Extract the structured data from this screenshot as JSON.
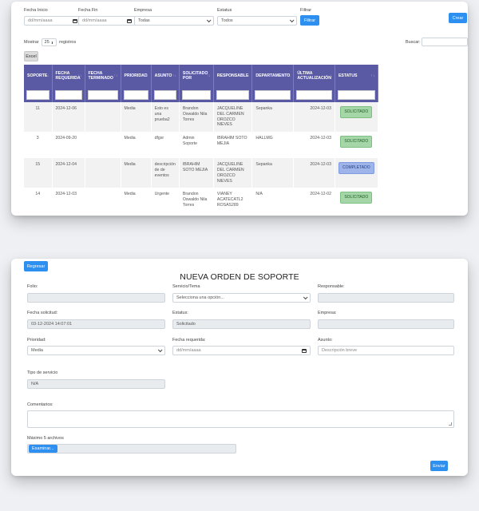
{
  "list_view": {
    "filters": {
      "fecha_inicio": {
        "label": "Fecha Inicio",
        "placeholder": "dd/mm/aaaa"
      },
      "fecha_fin": {
        "label": "Fecha Fin",
        "placeholder": "dd/mm/aaaa"
      },
      "empresa": {
        "label": "Empresa",
        "value": "Todas"
      },
      "estatus": {
        "label": "Estatus",
        "value": "Todos"
      },
      "filtrar": {
        "label": "Filtrar",
        "button": "Filtrar"
      }
    },
    "crear_button": "Crear",
    "mostrar": {
      "prefix": "Mostrar",
      "value": "25",
      "suffix": "registros"
    },
    "buscar_label": "Buscar:",
    "excel_button": "Excel",
    "columns": [
      "SOPORTE",
      "FECHA REQUERIDA",
      "FECHA TERMINADO",
      "PRIORIDAD",
      "ASUNTO",
      "SOLICITADO POR",
      "RESPONSABLE",
      "DEPARTAMENTO",
      "ÚLTIMA ACTUALIZACIÓN",
      "ESTATUS"
    ],
    "sort_icons": [
      "↑↓",
      "↑↓",
      "↑↓",
      "↑↓",
      "↑↓",
      "↑↓",
      "↑↓",
      "↑↓",
      "↓",
      "↑↓"
    ],
    "rows": [
      {
        "soporte": "11",
        "fecha_requerida": "2024-12-06",
        "fecha_terminado": "",
        "prioridad": "Media",
        "asunto": "Esto es una prueba2",
        "solicitado_por": "Brandon Oswaldo Nila Torres",
        "responsable": "JACQUELINE DEL CARMEN OROZCO NIEVES",
        "departamento": "Sepanka",
        "ultima_actualizacion": "2024-12-03",
        "estatus": "SOLICITADO",
        "estatus_color": "green"
      },
      {
        "soporte": "3",
        "fecha_requerida": "2024-09-20",
        "fecha_terminado": "",
        "prioridad": "Media",
        "asunto": "dfgsr",
        "solicitado_por": "Admin Soporte",
        "responsable": "IBRAHIM SOTO MEJIA",
        "departamento": "HALLMG",
        "ultima_actualizacion": "2024-12-03",
        "estatus": "SOLICITADO",
        "estatus_color": "green"
      },
      {
        "soporte": "15",
        "fecha_requerida": "2024-12-04",
        "fecha_terminado": "",
        "prioridad": "Media",
        "asunto": "descripción de de eventos",
        "solicitado_por": "IBRAHIM SOTO MEJIA",
        "responsable": "JACQUELINE DEL CARMEN OROZCO NIEVES",
        "departamento": "Sepanka",
        "ultima_actualizacion": "2024-12-03",
        "estatus": "COMPLETADO",
        "estatus_color": "blue"
      },
      {
        "soporte": "14",
        "fecha_requerida": "2024-12-03",
        "fecha_terminado": "",
        "prioridad": "Media",
        "asunto": "Urgente",
        "solicitado_por": "Brandon Oswaldo Nila Torres",
        "responsable": "VIANEY ACATECATL2 ROSAS289",
        "departamento": "N/A",
        "ultima_actualizacion": "2024-12-02",
        "estatus": "SOLICITADO",
        "estatus_color": "green"
      }
    ]
  },
  "form_view": {
    "regresar_button": "Regresar",
    "title": "NUEVA ORDEN DE SOPORTE",
    "folio": {
      "label": "Folio:",
      "value": ""
    },
    "servicio": {
      "label": "Servicio/Tema",
      "value": "Selecciona una opción..."
    },
    "responsable": {
      "label": "Responsable:",
      "value": ""
    },
    "fecha_solicitud": {
      "label": "Fecha solicitud:",
      "value": "03-12-2024 14:07:01"
    },
    "estatus": {
      "label": "Estatus:",
      "value": "Solicitado"
    },
    "empresa": {
      "label": "Empresa:",
      "value": ""
    },
    "prioridad": {
      "label": "Prioridad:",
      "value": "Media"
    },
    "fecha_requerida": {
      "label": "Fecha requerida:",
      "placeholder": "dd/mm/aaaa"
    },
    "asunto": {
      "label": "Asunto:",
      "placeholder": "Descripción breve"
    },
    "tipo_servicio": {
      "label": "Tipo de servicio",
      "value": "N/A"
    },
    "comentarios": {
      "label": "Comentarios:"
    },
    "archivos": {
      "label": "Máximo 5 archivos",
      "button": "Examinar..."
    },
    "enviar_button": "Enviar"
  },
  "colors": {
    "header": "#5a59a3",
    "primary": "#2d8ff0",
    "solicitado": "#a5d6a7",
    "completado": "#9fb5ea"
  }
}
